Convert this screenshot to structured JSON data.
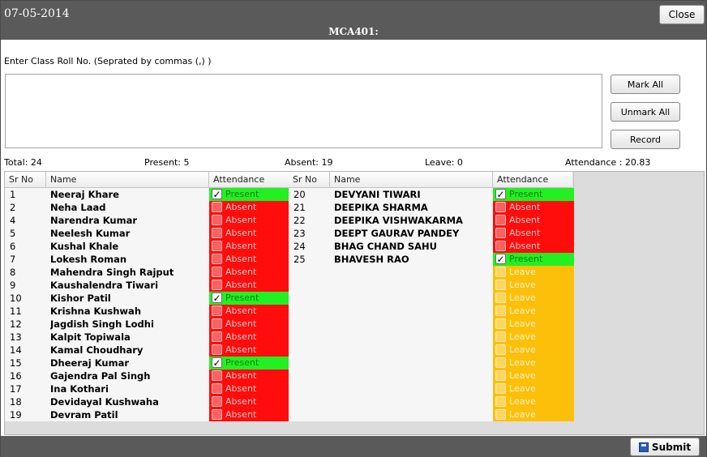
{
  "header": {
    "date": "07-05-2014",
    "course": "MCA401:",
    "close_label": "Close"
  },
  "roll_input": {
    "label": "Enter Class Roll No. (Seprated by commas (,) )",
    "value": ""
  },
  "buttons": {
    "mark_all": "Mark All",
    "unmark_all": "Unmark All",
    "record": "Record",
    "submit": "Submit"
  },
  "stats": {
    "total": "Total: 24",
    "present": "Present: 5",
    "absent": "Absent: 19",
    "leave": "Leave: 0",
    "attendance": "Attendance : 20.83"
  },
  "columns": {
    "sr": "Sr No",
    "name": "Name",
    "attendance": "Attendance"
  },
  "colors": {
    "present": "#22f022",
    "absent": "#ff0d0d",
    "leave": "#fdc00a",
    "bar": "#5a5a5a"
  },
  "students_left": [
    {
      "sr": "1",
      "name": "Neeraj Khare",
      "status": "Present",
      "checked": true
    },
    {
      "sr": "2",
      "name": "Neha Laad",
      "status": "Absent",
      "checked": false
    },
    {
      "sr": "4",
      "name": "Narendra Kumar",
      "status": "Absent",
      "checked": false
    },
    {
      "sr": "5",
      "name": "Neelesh Kumar",
      "status": "Absent",
      "checked": false
    },
    {
      "sr": "6",
      "name": "Kushal Khale",
      "status": "Absent",
      "checked": false
    },
    {
      "sr": "7",
      "name": "Lokesh Roman",
      "status": "Absent",
      "checked": false
    },
    {
      "sr": "8",
      "name": "Mahendra Singh Rajput",
      "status": "Absent",
      "checked": false
    },
    {
      "sr": "9",
      "name": "Kaushalendra Tiwari",
      "status": "Absent",
      "checked": false
    },
    {
      "sr": "10",
      "name": "Kishor Patil",
      "status": "Present",
      "checked": true
    },
    {
      "sr": "11",
      "name": "Krishna Kushwah",
      "status": "Absent",
      "checked": false
    },
    {
      "sr": "12",
      "name": "Jagdish Singh Lodhi",
      "status": "Absent",
      "checked": false
    },
    {
      "sr": "13",
      "name": "Kalpit Topiwala",
      "status": "Absent",
      "checked": false
    },
    {
      "sr": "14",
      "name": "Kamal Choudhary",
      "status": "Absent",
      "checked": false
    },
    {
      "sr": "15",
      "name": "Dheeraj Kumar",
      "status": "Present",
      "checked": true
    },
    {
      "sr": "16",
      "name": "Gajendra Pal Singh",
      "status": "Absent",
      "checked": false
    },
    {
      "sr": "17",
      "name": "Ina Kothari",
      "status": "Absent",
      "checked": false
    },
    {
      "sr": "18",
      "name": "Devidayal Kushwaha",
      "status": "Absent",
      "checked": false
    },
    {
      "sr": "19",
      "name": "Devram Patil",
      "status": "Absent",
      "checked": false
    }
  ],
  "students_right": [
    {
      "sr": "20",
      "name": "DEVYANI TIWARI",
      "status": "Present",
      "checked": true
    },
    {
      "sr": "21",
      "name": "DEEPIKA SHARMA",
      "status": "Absent",
      "checked": false
    },
    {
      "sr": "22",
      "name": "DEEPIKA VISHWAKARMA",
      "status": "Absent",
      "checked": false
    },
    {
      "sr": "23",
      "name": "DEEPT GAURAV PANDEY",
      "status": "Absent",
      "checked": false
    },
    {
      "sr": "24",
      "name": "BHAG CHAND SAHU",
      "status": "Absent",
      "checked": false
    },
    {
      "sr": "25",
      "name": "BHAVESH RAO",
      "status": "Present",
      "checked": true
    },
    {
      "sr": "",
      "name": "",
      "status": "Leave",
      "checked": false
    },
    {
      "sr": "",
      "name": "",
      "status": "Leave",
      "checked": false
    },
    {
      "sr": "",
      "name": "",
      "status": "Leave",
      "checked": false
    },
    {
      "sr": "",
      "name": "",
      "status": "Leave",
      "checked": false
    },
    {
      "sr": "",
      "name": "",
      "status": "Leave",
      "checked": false
    },
    {
      "sr": "",
      "name": "",
      "status": "Leave",
      "checked": false
    },
    {
      "sr": "",
      "name": "",
      "status": "Leave",
      "checked": false
    },
    {
      "sr": "",
      "name": "",
      "status": "Leave",
      "checked": false
    },
    {
      "sr": "",
      "name": "",
      "status": "Leave",
      "checked": false
    },
    {
      "sr": "",
      "name": "",
      "status": "Leave",
      "checked": false
    },
    {
      "sr": "",
      "name": "",
      "status": "Leave",
      "checked": false
    },
    {
      "sr": "",
      "name": "",
      "status": "Leave",
      "checked": false
    }
  ]
}
